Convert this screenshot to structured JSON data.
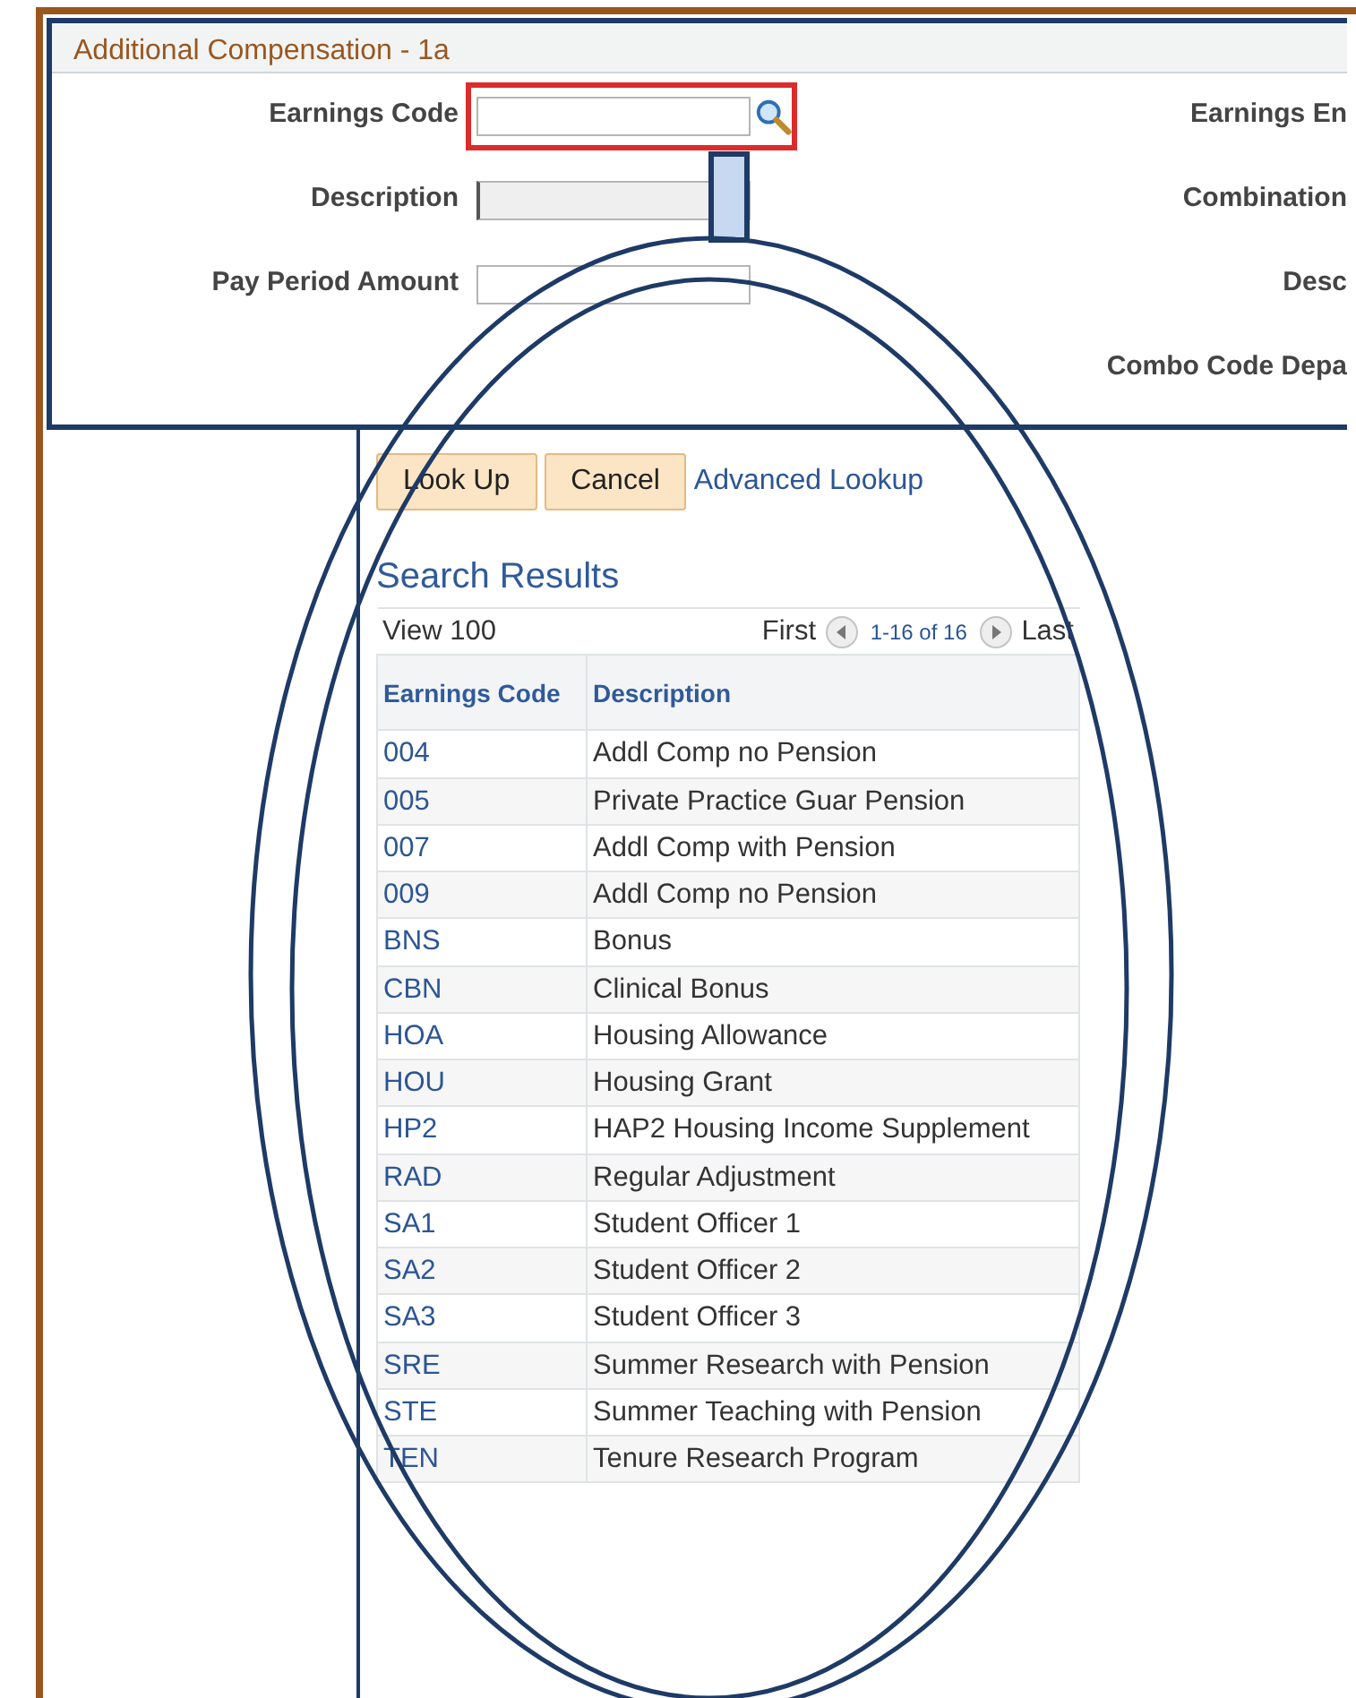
{
  "panel": {
    "title": "Additional Compensation - 1a"
  },
  "fields": [
    {
      "label": "Earnings Code",
      "kind": "lookup",
      "highlighted": true
    },
    {
      "label": "Description",
      "kind": "readonly",
      "highlighted": false
    },
    {
      "label": "Pay Period Amount",
      "kind": "text",
      "highlighted": false
    }
  ],
  "right_labels": [
    "Earnings En",
    "Combination",
    "Desc",
    "Combo Code Depa"
  ],
  "lookup": {
    "buttons": [
      "Look Up",
      "Cancel"
    ],
    "link": "Advanced Lookup",
    "results_title": "Search Results",
    "view_all": "View 100",
    "first": "First",
    "range": "1-16 of 16",
    "last": "Last",
    "columns": [
      "Earnings Code",
      "Description"
    ],
    "rows": [
      [
        "004",
        "Addl Comp no Pension"
      ],
      [
        "005",
        "Private Practice Guar  Pension"
      ],
      [
        "007",
        "Addl Comp with Pension"
      ],
      [
        "009",
        "Addl Comp no Pension"
      ],
      [
        "BNS",
        "Bonus"
      ],
      [
        "CBN",
        "Clinical Bonus"
      ],
      [
        "HOA",
        "Housing Allowance"
      ],
      [
        "HOU",
        "Housing Grant"
      ],
      [
        "HP2",
        "HAP2 Housing Income Supplement"
      ],
      [
        "RAD",
        "Regular Adjustment"
      ],
      [
        "SA1",
        "Student Officer 1"
      ],
      [
        "SA2",
        "Student Officer 2"
      ],
      [
        "SA3",
        "Student Officer 3"
      ],
      [
        "SRE",
        "Summer Research with Pension"
      ],
      [
        "STE",
        "Summer Teaching with Pension"
      ],
      [
        "TEN",
        "Tenure Research Program"
      ]
    ]
  }
}
